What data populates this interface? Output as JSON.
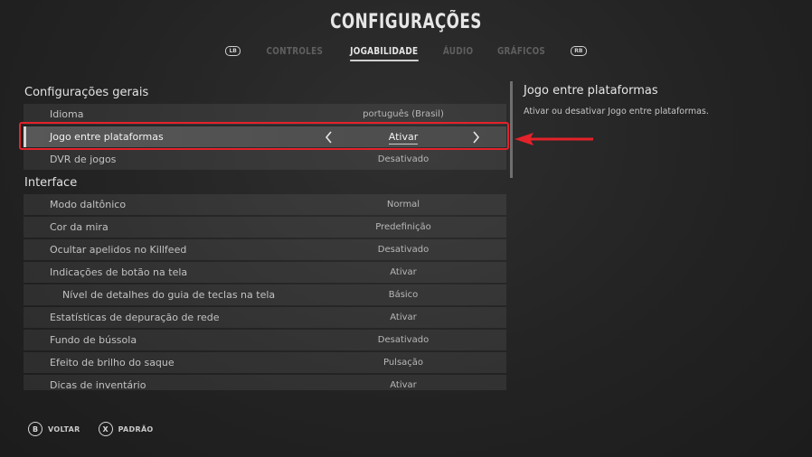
{
  "title": "CONFIGURAÇÕES",
  "bumpers": {
    "left": "LB",
    "right": "RB"
  },
  "tabs": [
    {
      "label": "CONTROLES"
    },
    {
      "label": "JOGABILIDADE"
    },
    {
      "label": "ÁUDIO"
    },
    {
      "label": "GRÁFICOS"
    }
  ],
  "sections": {
    "general": {
      "title": "Configurações gerais",
      "rows": [
        {
          "label": "Idioma",
          "value": "português (Brasil)"
        },
        {
          "label": "Jogo entre plataformas",
          "value": "Ativar"
        },
        {
          "label": "DVR de jogos",
          "value": "Desativado"
        }
      ]
    },
    "interface": {
      "title": "Interface",
      "rows": [
        {
          "label": "Modo daltônico",
          "value": "Normal"
        },
        {
          "label": "Cor da mira",
          "value": "Predefinição"
        },
        {
          "label": "Ocultar apelidos no Killfeed",
          "value": "Desativado"
        },
        {
          "label": "Indicações de botão na tela",
          "value": "Ativar"
        },
        {
          "label": "Nível de detalhes do guia de teclas na tela",
          "value": "Básico"
        },
        {
          "label": "Estatísticas de depuração de rede",
          "value": "Ativar"
        },
        {
          "label": "Fundo de bússola",
          "value": "Desativado"
        },
        {
          "label": "Efeito de brilho do saque",
          "value": "Pulsação"
        },
        {
          "label": "Dicas de inventário",
          "value": "Ativar"
        }
      ]
    }
  },
  "description": {
    "title": "Jogo entre plataformas",
    "text": "Ativar ou desativar Jogo entre plataformas."
  },
  "footer": {
    "back": {
      "button": "B",
      "label": "VOLTAR"
    },
    "default": {
      "button": "X",
      "label": "PADRÃO"
    }
  },
  "colors": {
    "highlight": "#e3222a",
    "selected_row": "#585858"
  },
  "icons": {
    "prev": "chevron-left-icon",
    "next": "chevron-right-icon",
    "pointer": "red-arrow-icon"
  }
}
